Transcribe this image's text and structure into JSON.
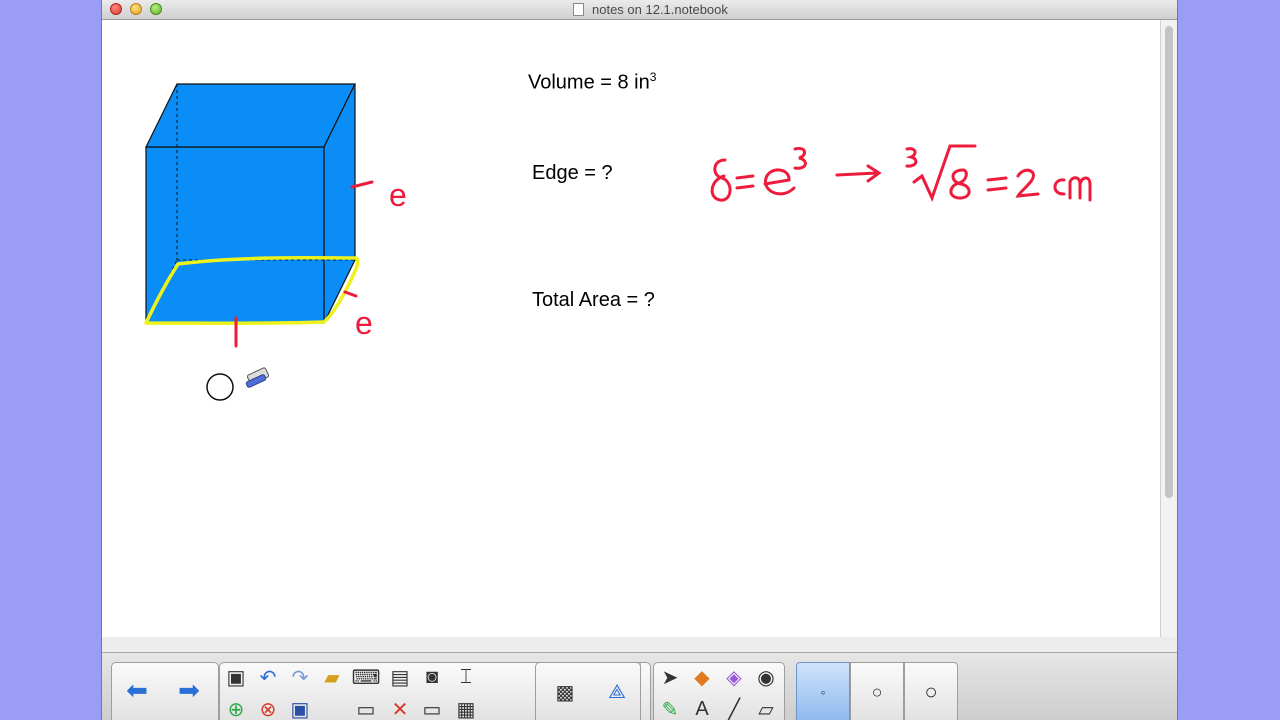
{
  "window": {
    "title": "notes on 12.1.notebook"
  },
  "canvas": {
    "volume_label": "Volume = 8 in",
    "volume_exponent": "3",
    "edge_label": "Edge = ?",
    "total_area_label": "Total Area = ?"
  },
  "handwriting": {
    "edge_label_right": "e",
    "edge_label_depth": "e",
    "equation": "8 = e3 → 3√8 = 2 cm"
  },
  "colors": {
    "cube_fill": "#0a8df7",
    "ink_red": "#ee1c3c",
    "ink_yellow": "#eef21c",
    "desktop": "#9b9cf5"
  },
  "toolbar": {
    "nav": [
      "back-arrow-icon",
      "forward-arrow-icon"
    ],
    "tools": [
      "view-screens-icon",
      "undo-icon",
      "redo-icon",
      "open-file-icon",
      "keyboard-icon",
      "paste-icon",
      "screen-capture-icon",
      "table-tool-icon",
      "add-page-icon",
      "delete-page-icon",
      "save-icon",
      "screen-shade-icon",
      "delete-icon",
      "full-screen-icon",
      "table-icon",
      "document-camera-icon",
      "video-icon",
      "compass-icon",
      "select-icon",
      "shapes-icon",
      "eraser-icon",
      "fill-icon",
      "pen-icon",
      "text-icon",
      "line-icon",
      "highlighter-icon"
    ],
    "pen_widths": [
      "pen-width-small-icon",
      "pen-width-medium-icon",
      "pen-width-large-icon"
    ]
  }
}
